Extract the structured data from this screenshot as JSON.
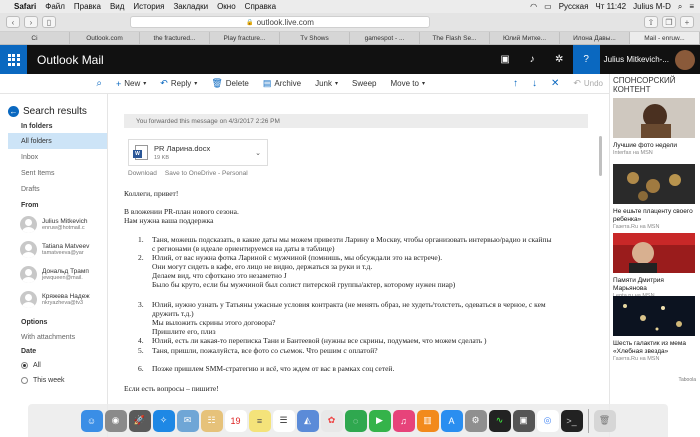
{
  "menubar": {
    "app": "Safari",
    "items": [
      "Файл",
      "Правка",
      "Вид",
      "История",
      "Закладки",
      "Окно",
      "Справка"
    ],
    "lang": "Русская",
    "clock": "Чт 11:42",
    "user": "Julius M-D"
  },
  "toolbar": {
    "url": "outlook.live.com"
  },
  "tabs": [
    "Ci",
    "Outlook.com",
    "the fractured...",
    "Play fracture...",
    "Tv Shows",
    "gamespot - ...",
    "The Flash Se...",
    "Юлий Митке...",
    "Илона Давы...",
    "Mail - enruw..."
  ],
  "header": {
    "brand": "Outlook Mail",
    "user": "Julius Mitkevich-..."
  },
  "commands": {
    "new": "New",
    "reply": "Reply",
    "delete": "Delete",
    "archive": "Archive",
    "junk": "Junk",
    "sweep": "Sweep",
    "move_to": "Move to",
    "undo": "Undo"
  },
  "left": {
    "search_results": "Search results",
    "in_folders": "In folders",
    "folders": [
      "All folders",
      "Inbox",
      "Sent Items",
      "Drafts"
    ],
    "from_label": "From",
    "people": [
      {
        "name": "Julius Mitkevich",
        "mail": "enruw@hotmail.c"
      },
      {
        "name": "Tatiana Matveev",
        "mail": "tamatveeva@yar"
      },
      {
        "name": "Дональд Трамп",
        "mail": "jewqueen@mail."
      },
      {
        "name": "Кряжева Надеж",
        "mail": "nkryazheva@tv3"
      }
    ],
    "options_label": "Options",
    "with_attachments": "With attachments",
    "date_label": "Date",
    "date_options": [
      "All",
      "This week"
    ]
  },
  "message": {
    "forwarded": "You forwarded this message on 4/3/2017 2:26 PM",
    "attachment": {
      "name": "PR Ларина.docx",
      "size": "19 KB"
    },
    "download": "Download",
    "save_onedrive": "Save to OneDrive - Personal",
    "greeting": "Коллеги, привет!",
    "intro1": "В вложении PR-план нового сезона.",
    "intro2": "Нам нужна ваша поддержка",
    "items": [
      {
        "num": "1.",
        "lines": [
          "Таня, можешь подсказать, в какие даты мы можем привезти Ларину в Москву, чтобы организовать интервью/радио и скайпы",
          "с регионами (в идеале ориентируемся на даты в таблице)"
        ]
      },
      {
        "num": "2.",
        "lines": [
          "Юлий, от вас нужна фотка Лариной с мужчиной (помнишь, мы обсуждали это на встрече).",
          "Они могут сидеть в кафе, его лицо не видно, держаться за руки и т.д.",
          "Делаем вид, что сфоткано это незаметно J",
          "Было бы круто, если бы мужчиной был солист питерской группы/актер, которому нужен пиар)"
        ]
      },
      {
        "num": "3.",
        "lines": [
          "Юлий, нужно узнать у Татьяны ужасные условия контракта (не менять образ, не худеть/толстеть, одеваться в черное, с кем",
          "дружить т.д.)",
          "Мы выложить скрины этого договора?",
          "Пришлите его, плиз"
        ]
      },
      {
        "num": "4.",
        "lines": [
          "Юлий, есть ли какая-то переписка Тани и Бантеевой (нужны все скрины, подумаем, что можем сделать )"
        ]
      },
      {
        "num": "5.",
        "lines": [
          "Таня, пришли, пожалуйста, все фото со съемок. Что решим с оплатой?"
        ]
      },
      {
        "num": "6.",
        "lines": [
          "Позже пришлем SMM-стратегию и всё, что ждем от вас в рамках соц сетей."
        ]
      }
    ],
    "closing": "Если есть вопросы – пишите!"
  },
  "ads": {
    "title": "СПОНСОРСКИЙ КОНТЕНТ",
    "items": [
      {
        "title": "Лучшие фото недели",
        "source": "Interfax на MSN"
      },
      {
        "title": "Не ешьте плаценту своего ребенка»",
        "source": "Газета.Ru на MSN"
      },
      {
        "title": "Памяти Дмитрия Марьянова",
        "source": "Lenta.ru на MSN"
      },
      {
        "title": "Шесть галактик из мема «Хлебная звезда»",
        "source": "Газета.Ru на MSN"
      }
    ],
    "footer": "Taboola"
  },
  "colors": {
    "accent": "#0a68c0",
    "header": "#111111"
  }
}
